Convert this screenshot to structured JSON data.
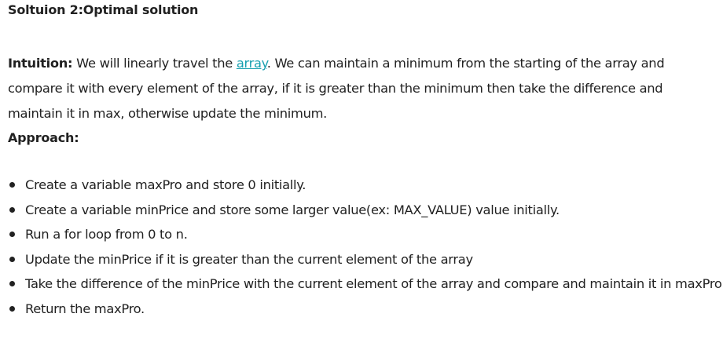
{
  "heading": "Soltuion 2:Optimal solution",
  "intuition": {
    "label": "Intuition:",
    "before_link": " We will linearly travel the ",
    "link_text": "array",
    "after_link": ". We can maintain a minimum from the starting of the array and compare it with every element of the array, if it is greater than the minimum then take the difference and maintain it in max, otherwise update the minimum."
  },
  "approach_label": "Approach:",
  "steps": [
    "Create a variable maxPro and store 0 initially.",
    "Create a variable minPrice and store some larger value(ex: MAX_VALUE) value initially.",
    "Run a for loop from 0 to n.",
    "Update the minPrice if it is greater than the current element of the array",
    "Take the difference of the minPrice with the current element of the array and compare and maintain it in maxPro.",
    "Return the maxPro."
  ],
  "colors": {
    "text": "#212121",
    "link": "#18a0b0",
    "background": "#ffffff"
  }
}
